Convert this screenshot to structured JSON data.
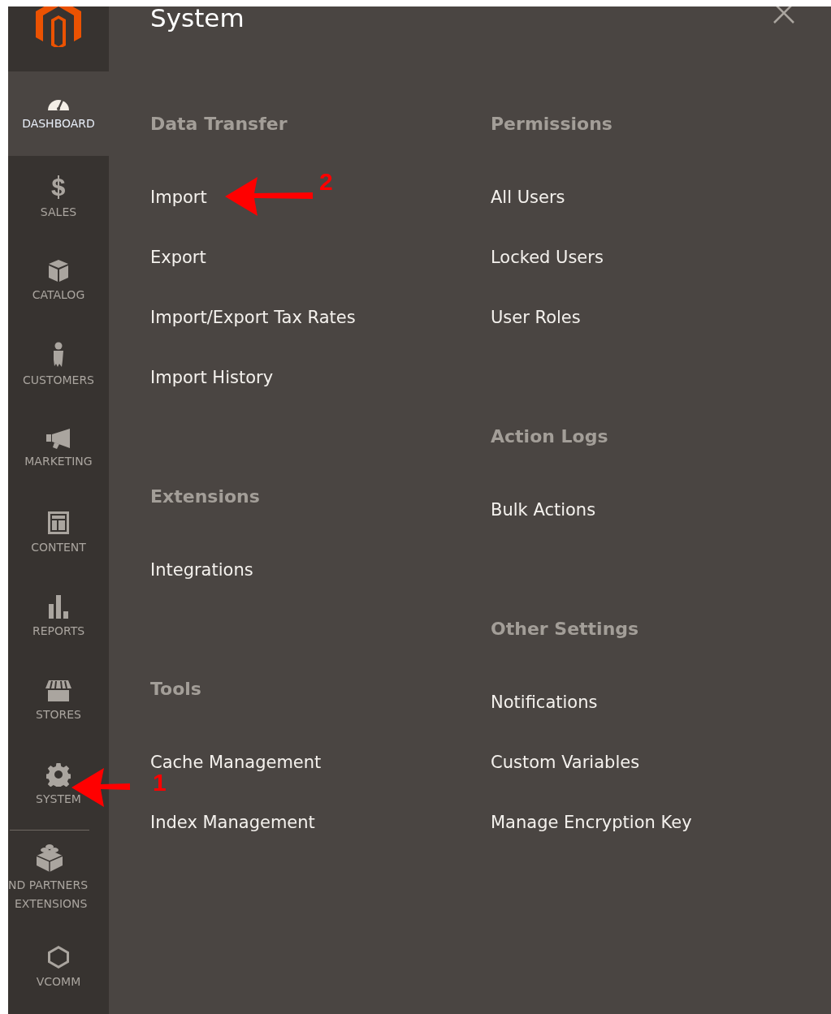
{
  "sidebar": {
    "items": [
      {
        "kind": "dashboard",
        "label": "DASHBOARD",
        "selected": true
      },
      {
        "kind": "sales",
        "label": "SALES",
        "selected": false
      },
      {
        "kind": "catalog",
        "label": "CATALOG",
        "selected": false
      },
      {
        "kind": "customers",
        "label": "CUSTOMERS",
        "selected": false
      },
      {
        "kind": "marketing",
        "label": "MARKETING",
        "selected": false
      },
      {
        "kind": "content",
        "label": "CONTENT",
        "selected": false
      },
      {
        "kind": "reports",
        "label": "REPORTS",
        "selected": false
      },
      {
        "kind": "stores",
        "label": "STORES",
        "selected": false
      },
      {
        "kind": "system",
        "label": "SYSTEM",
        "selected": false,
        "annotation": "1"
      },
      {
        "kind": "extensions",
        "label": "ND PARTNERS",
        "label2": "EXTENSIONS",
        "selected": false
      },
      {
        "kind": "vcomm",
        "label": "VCOMM",
        "selected": false
      }
    ]
  },
  "panel": {
    "title": "System",
    "columns": [
      [
        {
          "heading": "Data Transfer",
          "items": [
            {
              "label": "Import",
              "annotation": "2"
            },
            {
              "label": "Export"
            },
            {
              "label": "Import/Export Tax Rates"
            },
            {
              "label": "Import History"
            }
          ]
        },
        {
          "heading": "Extensions",
          "items": [
            {
              "label": "Integrations"
            }
          ]
        },
        {
          "heading": "Tools",
          "items": [
            {
              "label": "Cache Management"
            },
            {
              "label": "Index Management"
            }
          ]
        }
      ],
      [
        {
          "heading": "Permissions",
          "items": [
            {
              "label": "All Users"
            },
            {
              "label": "Locked Users"
            },
            {
              "label": "User Roles"
            }
          ]
        },
        {
          "heading": "Action Logs",
          "items": [
            {
              "label": "Bulk Actions"
            }
          ]
        },
        {
          "heading": "Other Settings",
          "items": [
            {
              "label": "Notifications"
            },
            {
              "label": "Custom Variables"
            },
            {
              "label": "Manage Encryption Key"
            }
          ]
        }
      ]
    ]
  }
}
